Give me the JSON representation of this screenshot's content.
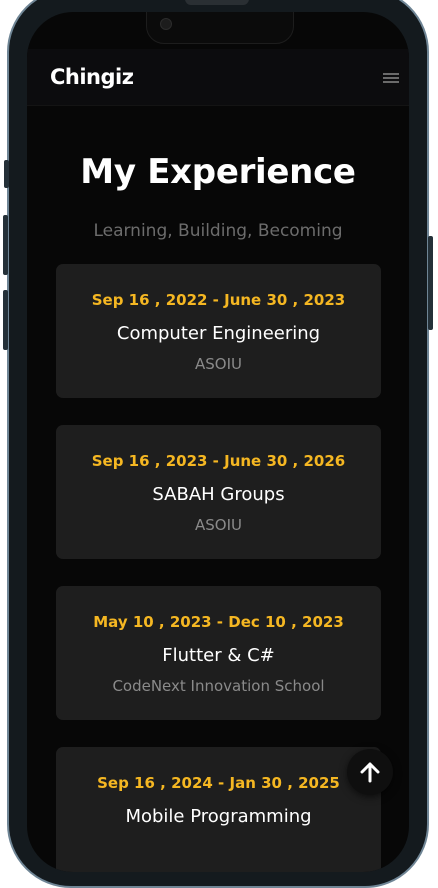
{
  "header": {
    "logo": "Chingiz",
    "menu_icon": "hamburger-menu-icon"
  },
  "section": {
    "title": "My Experience",
    "subtitle": "Learning, Building, Becoming"
  },
  "experiences": [
    {
      "date": "Sep 16 , 2022 - June 30 , 2023",
      "role": "Computer Engineering",
      "org": "ASOIU"
    },
    {
      "date": "Sep 16 , 2023 - June 30 , 2026",
      "role": "SABAH Groups",
      "org": "ASOIU"
    },
    {
      "date": "May 10 , 2023 - Dec 10 , 2023",
      "role": "Flutter & C#",
      "org": "CodeNext Innovation School"
    },
    {
      "date": "Sep 16 , 2024 - Jan 30 , 2025",
      "role": "Mobile Programming",
      "org": ""
    }
  ],
  "scroll_top_icon": "arrow-up-icon",
  "colors": {
    "accent": "#f5b722",
    "background": "#070707",
    "card": "#1e1e1e"
  }
}
